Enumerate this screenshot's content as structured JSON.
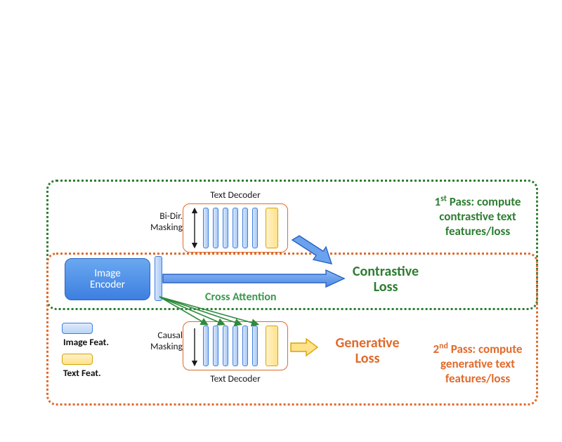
{
  "colors": {
    "green": "#2e7d32",
    "orange": "#e06a2b",
    "blue_fill": "#5b93e6",
    "blue_stroke": "#3d7fe0",
    "yellow_stroke": "#d6a400",
    "cross_attn_green": "#3c984c"
  },
  "image_encoder": {
    "label": "Image\nEncoder"
  },
  "decoders": {
    "top": {
      "caption": "Text Decoder",
      "masking": "Bi-Dir.\nMasking"
    },
    "bottom": {
      "caption": "Text Decoder",
      "masking": "Causal\nMasking"
    }
  },
  "cross_attention_label": "Cross Attention",
  "contrastive_loss": "Contrastive\nLoss",
  "generative_loss": "Generative\nLoss",
  "pass1": "1ˢᵗ Pass: compute\ncontrastive text\nfeatures/loss",
  "pass2": "2ⁿᵈ Pass: compute\ngenerative text\nfeatures/loss",
  "legend": {
    "image_feat": "Image Feat.",
    "text_feat": "Text Feat."
  }
}
